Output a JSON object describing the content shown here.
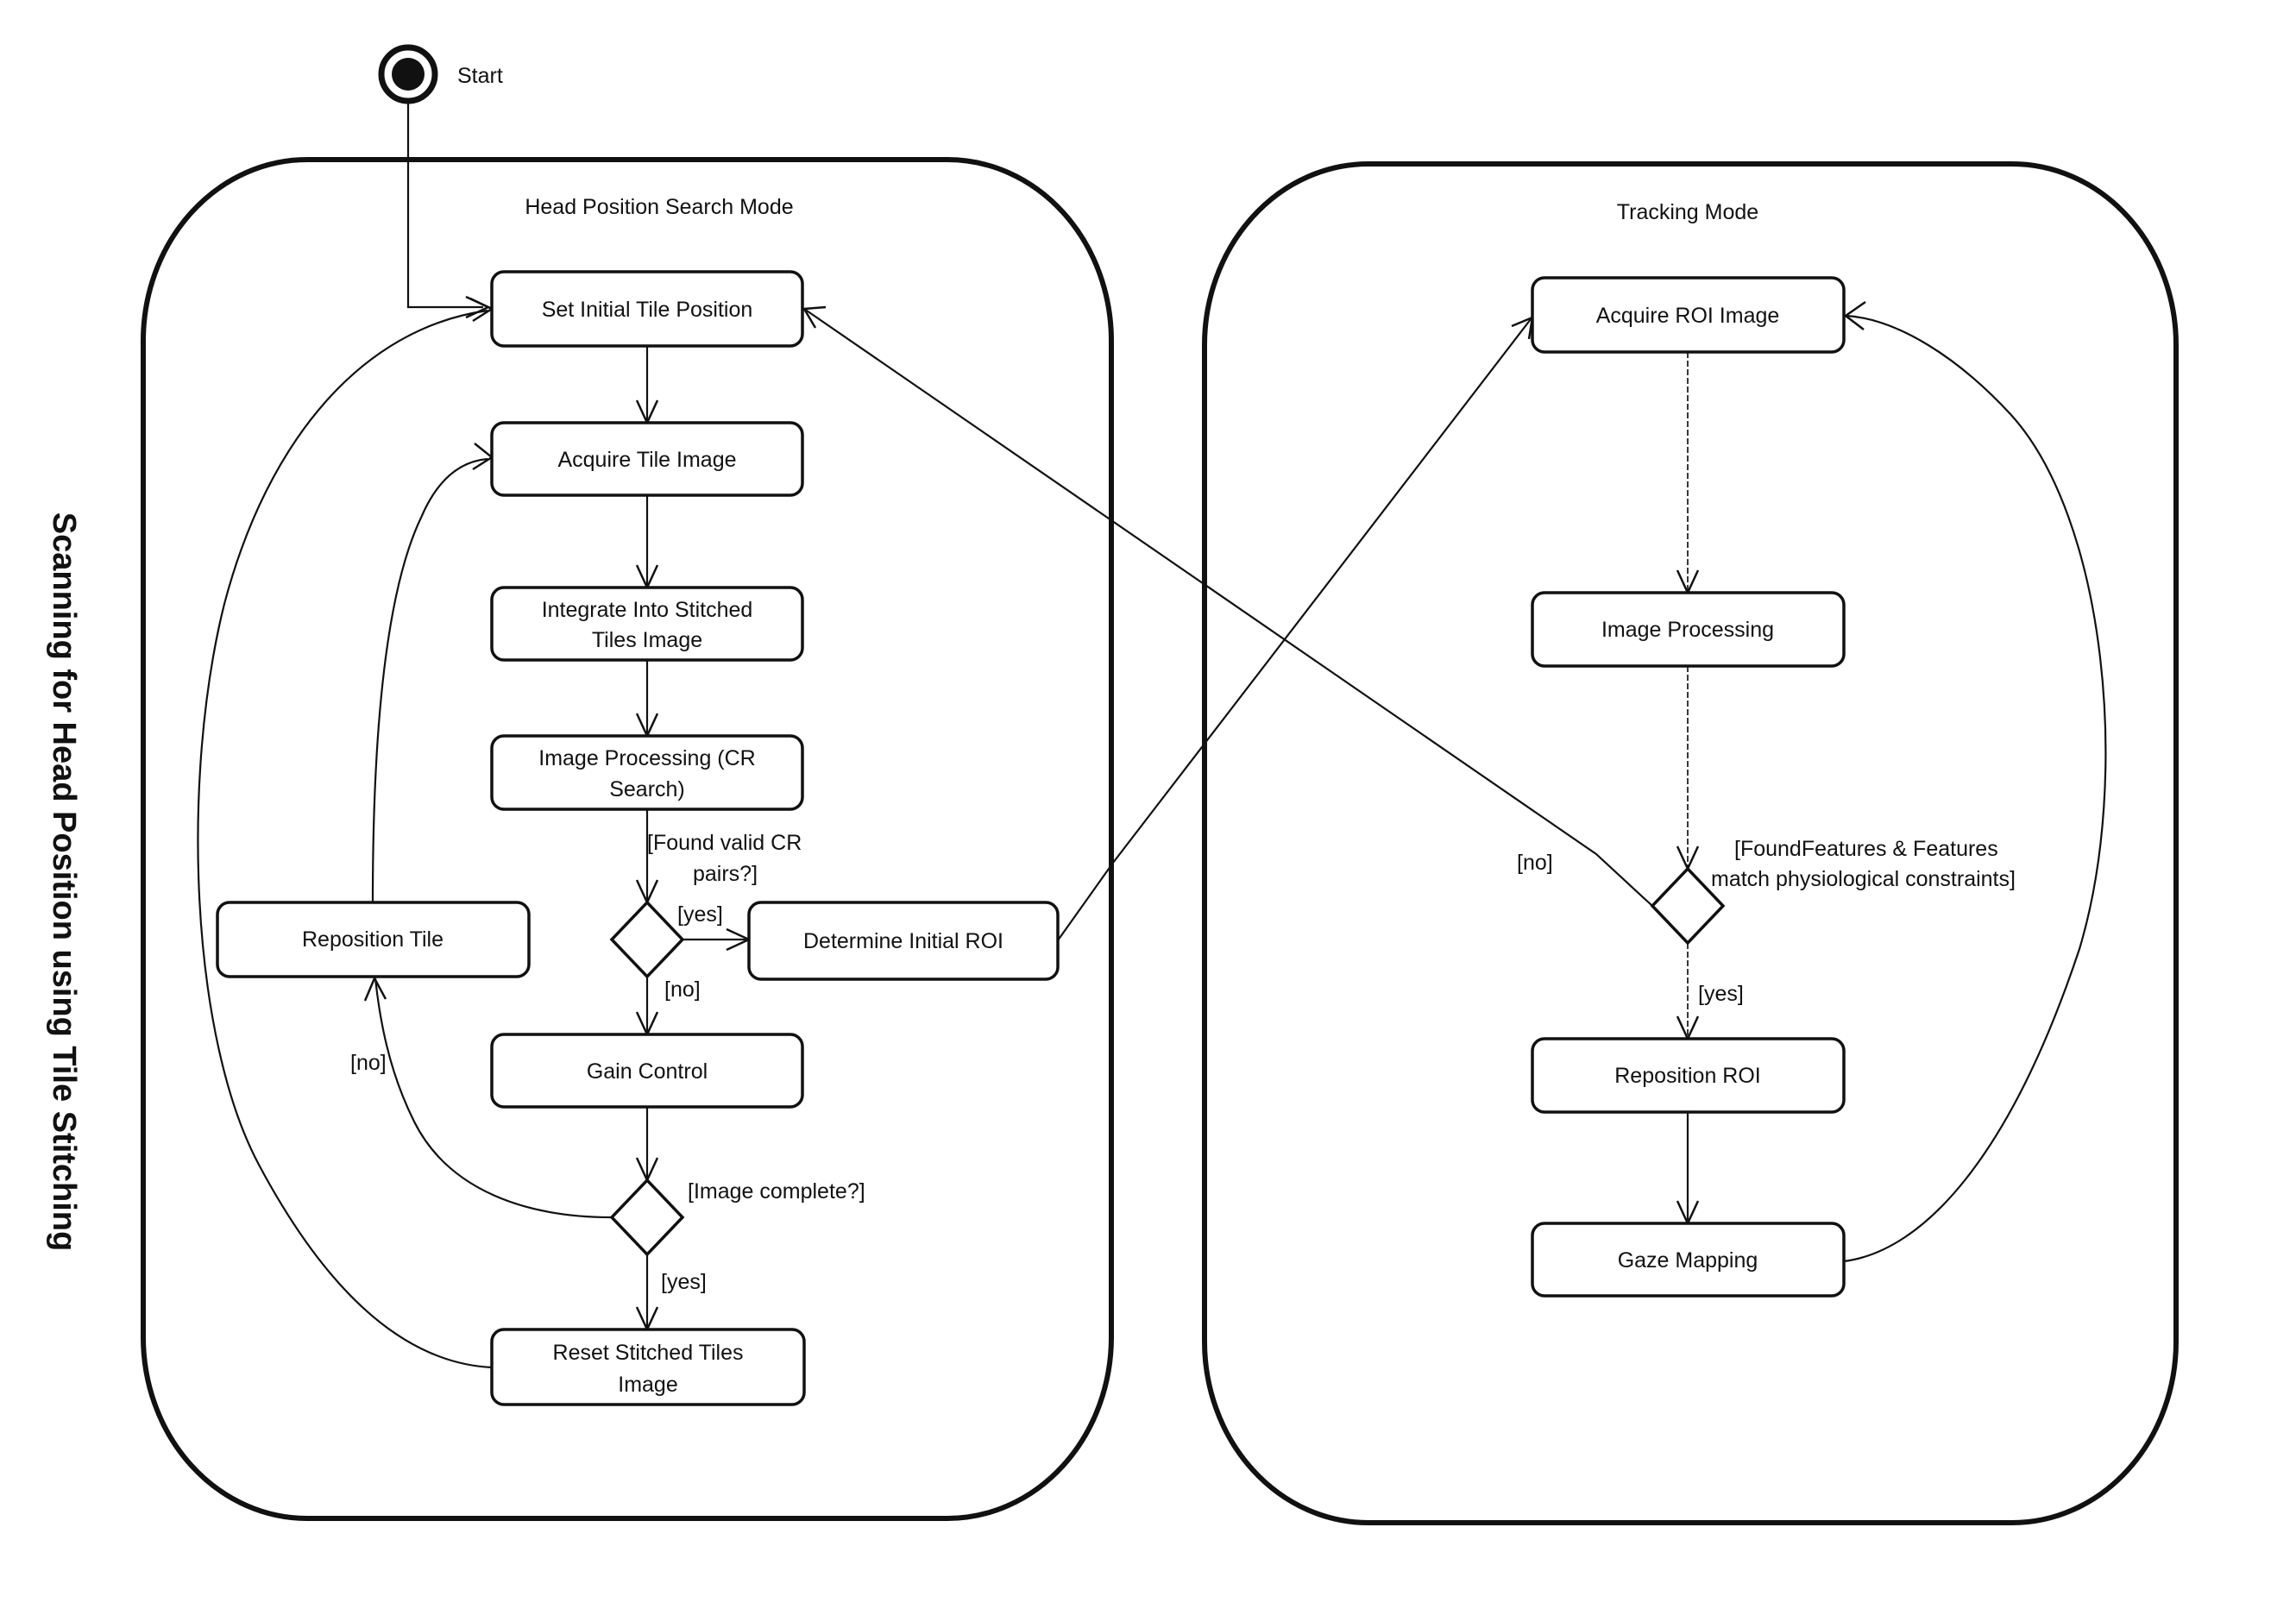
{
  "diagram": {
    "title": "Scanning for Head Position using Tile Stitching",
    "start_label": "Start",
    "modes": {
      "search": {
        "title": "Head Position Search Mode",
        "nodes": {
          "set_initial_tile_position": "Set Initial Tile Position",
          "acquire_tile_image": "Acquire Tile Image",
          "integrate_line1": "Integrate Into Stitched",
          "integrate_line2": "Tiles Image",
          "image_processing_cr_line1": "Image Processing (CR",
          "image_processing_cr_line2": "Search)",
          "reposition_tile": "Reposition Tile",
          "determine_initial_roi": "Determine Initial ROI",
          "gain_control": "Gain Control",
          "reset_line1": "Reset Stitched Tiles",
          "reset_line2": "Image"
        },
        "guards": {
          "found_valid_cr_line1": "[Found valid CR",
          "found_valid_cr_line2": "pairs?]",
          "yes_roi": "[yes]",
          "no_gain": "[no]",
          "image_complete": "[Image complete?]",
          "no_reposition": "[no]",
          "yes_reset": "[yes]"
        }
      },
      "tracking": {
        "title": "Tracking Mode",
        "nodes": {
          "acquire_roi_image": "Acquire ROI Image",
          "image_processing": "Image Processing",
          "reposition_roi": "Reposition ROI",
          "gaze_mapping": "Gaze Mapping"
        },
        "guards": {
          "features_line1": "[FoundFeatures & Features",
          "features_line2": "match physiological constraints]",
          "no_back": "[no]",
          "yes_reposition": "[yes]"
        }
      }
    }
  }
}
